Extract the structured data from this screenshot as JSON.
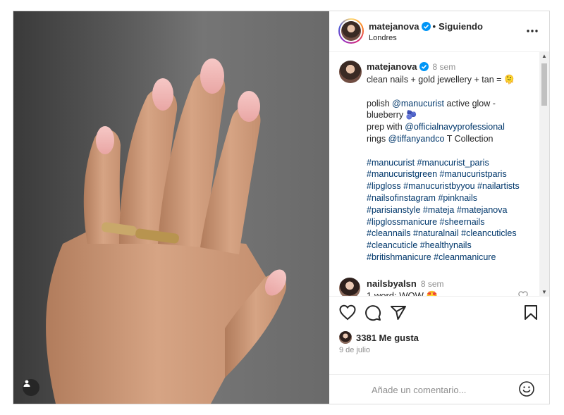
{
  "header": {
    "username": "matejanova",
    "separator": "•",
    "follow_status": "Siguiendo",
    "location": "Londres"
  },
  "caption": {
    "username": "matejanova",
    "time": "8 sem",
    "lines": [
      {
        "text": "clean nails + gold jewellery + tan = 🫠"
      },
      {
        "gap": true
      },
      {
        "parts": [
          {
            "t": "polish "
          },
          {
            "t": "@manucurist",
            "link": true
          },
          {
            "t": " active glow -"
          }
        ]
      },
      {
        "text": "blueberry 🫐"
      },
      {
        "parts": [
          {
            "t": "prep with "
          },
          {
            "t": "@officialnavyprofessional",
            "link": true
          }
        ]
      },
      {
        "parts": [
          {
            "t": "rings "
          },
          {
            "t": "@tiffanyandco",
            "link": true
          },
          {
            "t": " T Collection"
          }
        ]
      },
      {
        "gap": true
      },
      {
        "parts": [
          {
            "t": "#manucurist #manucurist_paris",
            "link": true
          }
        ]
      },
      {
        "parts": [
          {
            "t": "#manucuristgreen #manucuristparis",
            "link": true
          }
        ]
      },
      {
        "parts": [
          {
            "t": "#lipgloss #manucuristbyyou #nailartists",
            "link": true
          }
        ]
      },
      {
        "parts": [
          {
            "t": "#nailsofinstagram #pinknails",
            "link": true
          }
        ]
      },
      {
        "parts": [
          {
            "t": "#parisianstyle #mateja #matejanova",
            "link": true
          }
        ]
      },
      {
        "parts": [
          {
            "t": "#lipglossmanicure #sheernails",
            "link": true
          }
        ]
      },
      {
        "parts": [
          {
            "t": "#cleannails #naturalnail #cleancuticles",
            "link": true
          }
        ]
      },
      {
        "parts": [
          {
            "t": "#cleancuticle #healthynails",
            "link": true
          }
        ]
      },
      {
        "parts": [
          {
            "t": "#britishmanicure #cleanmanicure",
            "link": true
          }
        ]
      }
    ]
  },
  "comment": {
    "username": "nailsbyalsn",
    "time": "8 sem",
    "text": "1 word: WOW 🤩"
  },
  "likes": {
    "count_text": "3381 Me gusta"
  },
  "date": "9 de julio",
  "comment_box": {
    "placeholder": "Añade un comentario..."
  },
  "icons": {
    "header_more": "more-horizontal-icon",
    "verified": "verified-badge-icon",
    "like": "heart-icon",
    "comment": "comment-bubble-icon",
    "share": "paper-plane-icon",
    "save": "bookmark-icon",
    "emoji": "smiley-icon",
    "tag": "user-tag-icon"
  },
  "colors": {
    "link": "#00376b",
    "verified": "#0095f6",
    "muted": "#8e8e8e"
  }
}
